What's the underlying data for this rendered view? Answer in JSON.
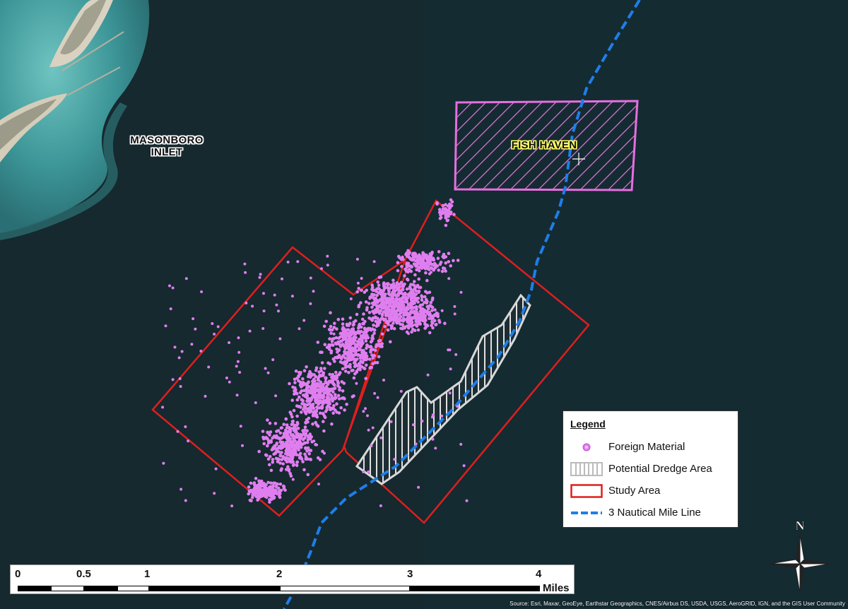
{
  "map": {
    "place_labels": [
      {
        "lines": [
          "MASONBORO",
          "INLET"
        ]
      }
    ],
    "feature_labels": [
      {
        "text": "FISH HAVEN"
      }
    ],
    "colors": {
      "water": "#15292f",
      "shallow_water": "#3f9a9c",
      "land": "#d8d0bd",
      "foreign_material": "#e07ef0",
      "study_area": "#e01e1e",
      "fish_haven": "#e86ee0",
      "dredge_area": "#d8d8d8",
      "nautical_line": "#1f7ee8"
    }
  },
  "legend": {
    "title": "Legend",
    "items": [
      {
        "label": "Foreign Material",
        "symbol": "pink-dot-icon"
      },
      {
        "label": "Potential Dredge Area",
        "symbol": "hatched-gray-box-icon"
      },
      {
        "label": "Study Area",
        "symbol": "red-outline-box-icon"
      },
      {
        "label": "3 Nautical Mile Line",
        "symbol": "blue-dashed-line-icon"
      }
    ]
  },
  "scale_bar": {
    "ticks": [
      "0",
      "0.5",
      "1",
      "2",
      "3",
      "4"
    ],
    "units": "Miles"
  },
  "north_arrow": {
    "label": "N"
  },
  "credits": "Source: Esri, Maxar, GeoEye, Earthstar Geographics, CNES/Airbus DS, USDA, USGS, AeroGRID, IGN, and the GIS User Community"
}
